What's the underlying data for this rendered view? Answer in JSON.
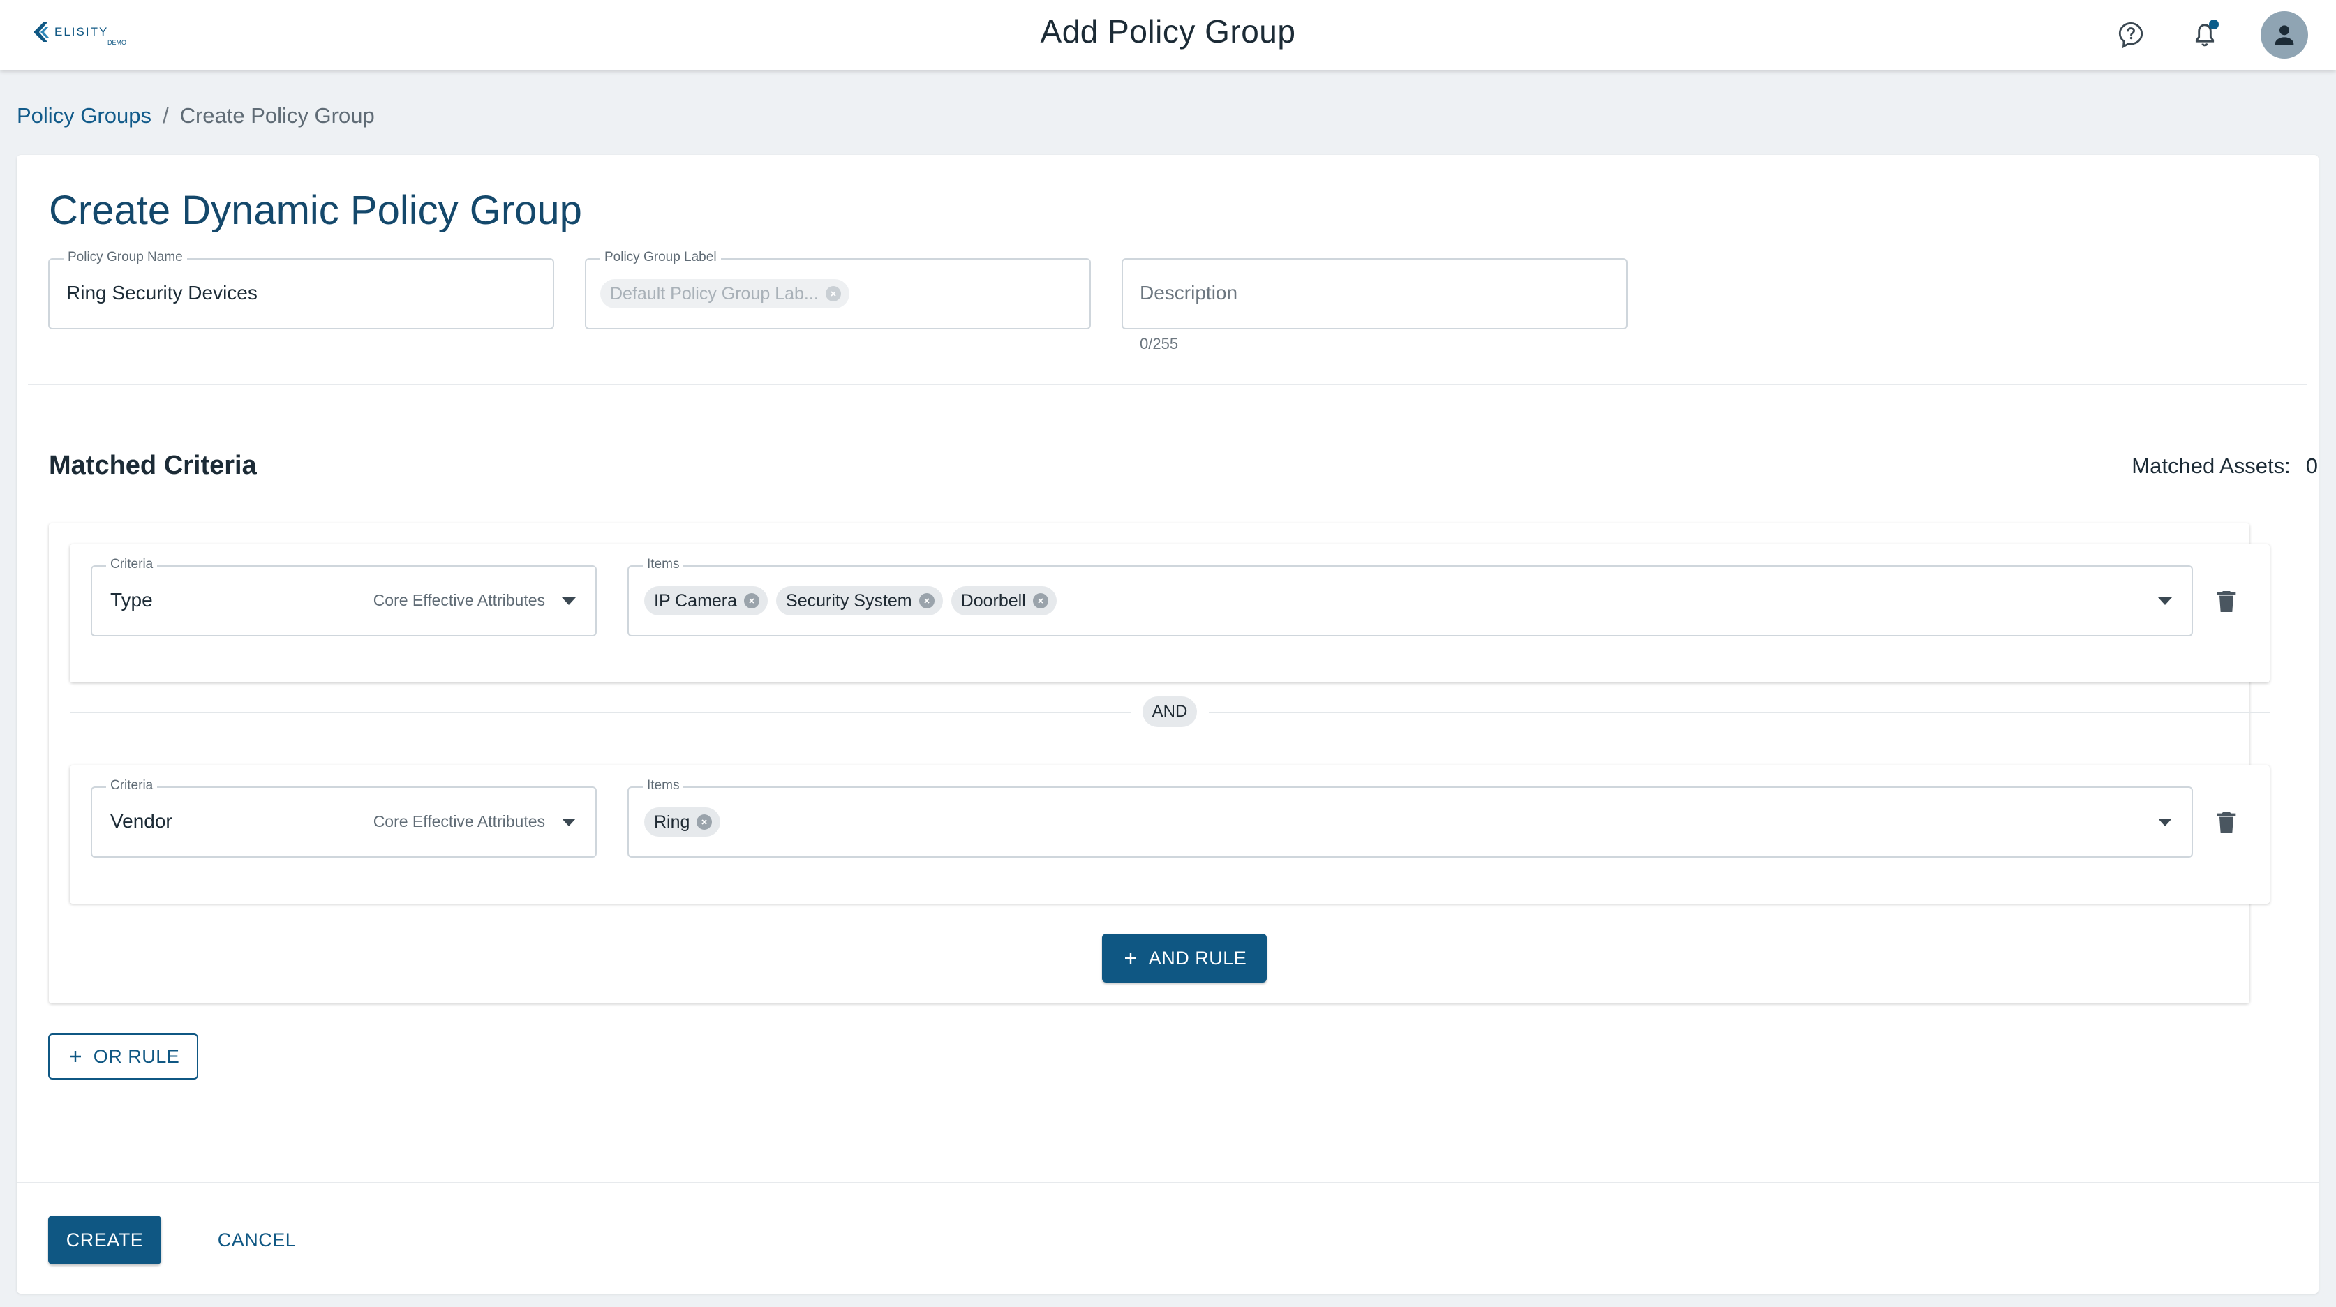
{
  "header": {
    "title": "Add Policy Group",
    "logo_text": "ELISITY",
    "logo_subtext": "DEMO"
  },
  "breadcrumb": {
    "parent": "Policy Groups",
    "separator": "/",
    "current": "Create Policy Group"
  },
  "form": {
    "heading": "Create Dynamic Policy Group",
    "name_label": "Policy Group Name",
    "name_value": "Ring Security Devices",
    "group_label_label": "Policy Group Label",
    "group_label_chip": "Default Policy Group Lab...",
    "description_placeholder": "Description",
    "description_counter": "0/255"
  },
  "criteria_section": {
    "title": "Matched Criteria",
    "matched_assets_label": "Matched Assets:",
    "matched_assets_count": "0",
    "rules": [
      {
        "criteria_label": "Criteria",
        "criteria_value": "Type",
        "criteria_category": "Core Effective Attributes",
        "items_label": "Items",
        "items": [
          "IP Camera",
          "Security System",
          "Doorbell"
        ]
      },
      {
        "criteria_label": "Criteria",
        "criteria_value": "Vendor",
        "criteria_category": "Core Effective Attributes",
        "items_label": "Items",
        "items": [
          "Ring"
        ]
      }
    ],
    "and_separator": "AND",
    "and_rule_button": "AND RULE",
    "or_rule_button": "OR RULE"
  },
  "footer": {
    "create_button": "CREATE",
    "cancel_button": "CANCEL"
  },
  "colors": {
    "primary": "#0f5783",
    "heading": "#14486b",
    "background": "#eef1f4",
    "notification_dot": "#0a5c8a"
  }
}
